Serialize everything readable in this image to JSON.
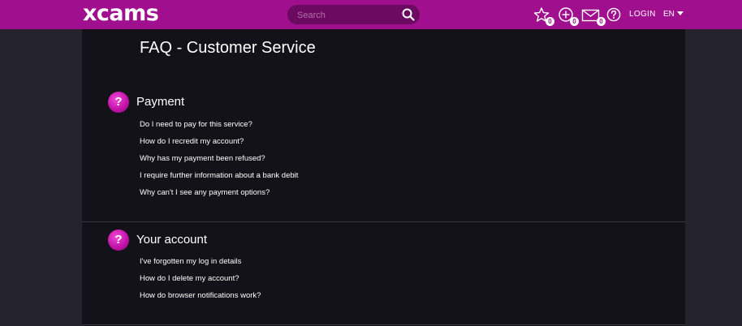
{
  "header": {
    "logo": "xcams",
    "search_placeholder": "Search",
    "favorites_count": "0",
    "credits_count": "0",
    "messages_count": "0",
    "login_label": "LOGIN",
    "language": "EN",
    "colors": {
      "brand": "#a0108e",
      "search_bg": "#6c0a61"
    },
    "icons": [
      "search-icon",
      "star-icon",
      "coin-icon",
      "envelope-icon",
      "help-icon",
      "chevron-down-icon"
    ]
  },
  "page": {
    "title": "FAQ - Customer Service"
  },
  "sections": [
    {
      "icon_glyph": "?",
      "title": "Payment",
      "links": [
        "Do I need to pay for this service?",
        "How do I recredit my account?",
        "Why has my payment been refused?",
        "I require further information about a bank debit",
        "Why can't I see any payment options?"
      ]
    },
    {
      "icon_glyph": "?",
      "title": "Your account",
      "links": [
        "I've forgotten my log in details",
        "How do I delete my account?",
        "How do browser notifications work?"
      ]
    }
  ]
}
